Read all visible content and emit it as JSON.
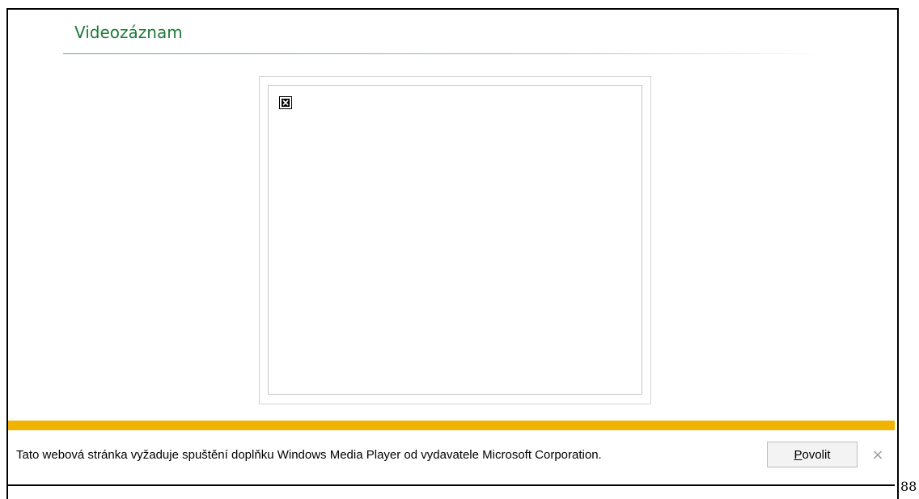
{
  "section": {
    "title": "Videozáznam"
  },
  "player": {
    "icon": "broken-plugin-icon"
  },
  "infobar": {
    "message": "Tato webová stránka vyžaduje spuštění doplňku Windows Media Player od vydavatele Microsoft Corporation.",
    "allow_button_accel": "P",
    "allow_button_rest": "ovolit",
    "close_glyph": "×",
    "stripe_color": "#f0b400"
  },
  "page": {
    "number": "88"
  }
}
